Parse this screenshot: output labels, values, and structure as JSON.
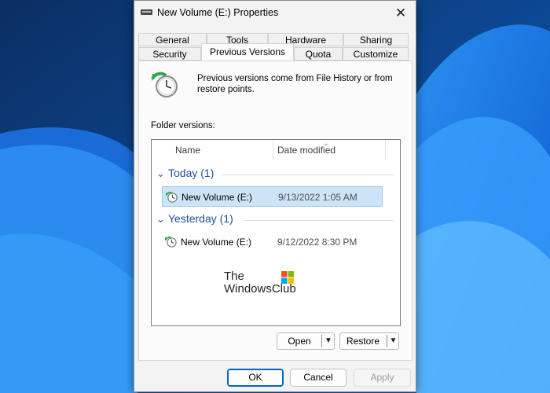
{
  "window": {
    "title": "New Volume (E:) Properties"
  },
  "tabs": {
    "row1": [
      "General",
      "Tools",
      "Hardware",
      "Sharing"
    ],
    "row2": [
      "Security",
      "Previous Versions",
      "Quota",
      "Customize"
    ],
    "active": "Previous Versions"
  },
  "info": {
    "text": "Previous versions come from File History or from restore points."
  },
  "folder_versions": {
    "label": "Folder versions:",
    "columns": [
      "Name",
      "Date modified"
    ],
    "groups": [
      {
        "title": "Today (1)",
        "items": [
          {
            "name": "New Volume (E:)",
            "date": "9/13/2022 1:05 AM",
            "selected": true
          }
        ]
      },
      {
        "title": "Yesterday (1)",
        "items": [
          {
            "name": "New Volume (E:)",
            "date": "9/12/2022 8:30 PM",
            "selected": false
          }
        ]
      }
    ]
  },
  "watermark": {
    "line1": "The",
    "line2": "WindowsClub"
  },
  "actions": {
    "open": "Open",
    "restore": "Restore"
  },
  "footer": {
    "ok": "OK",
    "cancel": "Cancel",
    "apply": "Apply"
  },
  "colors": {
    "accent": "#0067c0",
    "selection": "#cce4f7",
    "group_header": "#1d4f95"
  },
  "icons": {
    "window": "drive-icon",
    "close": "close-icon",
    "restore_point": "clock-restore-icon"
  }
}
